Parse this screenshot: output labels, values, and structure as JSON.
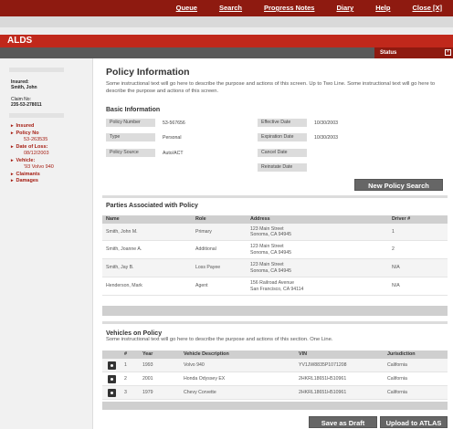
{
  "topnav": [
    "Queue",
    "Search",
    "Progress Notes",
    "Diary",
    "Help",
    "Close [X]"
  ],
  "app_title": "ALDS",
  "status_label": "Status",
  "sidebar": {
    "insured_label": "Insured:",
    "insured_name": "Smith, John",
    "claim_label": "Claim No:",
    "claim_no": "235-53-278011",
    "nav": [
      {
        "label": "Insured"
      },
      {
        "label": "Policy No",
        "value": "53-263535"
      },
      {
        "label": "Date of Loss:",
        "value": "08/12/2003"
      },
      {
        "label": "Vehicle:",
        "value": "'93 Volvo 940"
      },
      {
        "label": "Claimants"
      },
      {
        "label": "Damages"
      }
    ]
  },
  "page": {
    "title": "Policy Information",
    "intro": "Some instructional text will go here to describe the purpose and actions of this screen.  Up to Two Line. Some instructional text will go here to describe the purpose and actions of this screen.",
    "basic_heading": "Basic Information",
    "basic_left": [
      {
        "k": "Policy Number",
        "v": "53-567656"
      },
      {
        "k": "Type",
        "v": "Personal"
      },
      {
        "k": "Policy Source",
        "v": "Auto/ACT"
      }
    ],
    "basic_right": [
      {
        "k": "Effective Date",
        "v": "10/30/2003"
      },
      {
        "k": "Expiration Date",
        "v": "10/30/2003"
      },
      {
        "k": "Cancel Date",
        "v": ""
      },
      {
        "k": "Reinstate Date",
        "v": ""
      }
    ],
    "new_policy_search": "New Policy Search",
    "parties_heading": "Parties Associated with Policy",
    "parties_headers": [
      "Name",
      "Role",
      "Address",
      "Driver #"
    ],
    "parties": [
      {
        "name": "Smith, John M.",
        "role": "Primary",
        "addr1": "123 Main Street",
        "addr2": "Sonoma, CA 94945",
        "driver": "1"
      },
      {
        "name": "Smith, Joanne A.",
        "role": "Additional",
        "addr1": "123 Main Street",
        "addr2": "Sonoma, CA 94945",
        "driver": "2"
      },
      {
        "name": "Smith, Jay B.",
        "role": "Loss Payee",
        "addr1": "123 Main Street",
        "addr2": "Sonoma, CA 94945",
        "driver": "N/A"
      },
      {
        "name": "Henderson, Mark",
        "role": "Agent",
        "addr1": "156 Railroad Avenue",
        "addr2": "San Francisco, CA 94114",
        "driver": "N/A"
      }
    ],
    "vehicles_heading": "Vehicles on Policy",
    "vehicles_intro": "Some instructional text will go here to describe the purpose and actions of this section.  One Line.",
    "vehicles_headers": [
      "#",
      "Year",
      "Vehicle Description",
      "VIN",
      "Jurisdiction"
    ],
    "vehicles": [
      {
        "n": "1",
        "year": "1993",
        "desc": "Volvo 940",
        "vin": "YV1JW8835P1071208",
        "jur": "California"
      },
      {
        "n": "2",
        "year": "2001",
        "desc": "Honda Odyssey EX",
        "vin": "2HKRL18651H510961",
        "jur": "California"
      },
      {
        "n": "3",
        "year": "1979",
        "desc": "Chevy Corvette",
        "vin": "2HKRL18651H510961",
        "jur": "California"
      }
    ],
    "save_draft": "Save as Draft",
    "upload": "Upload to ATLAS"
  },
  "colors": {
    "brand_dark": "#8e1a10",
    "brand": "#c0281b",
    "link": "#a51d12"
  }
}
